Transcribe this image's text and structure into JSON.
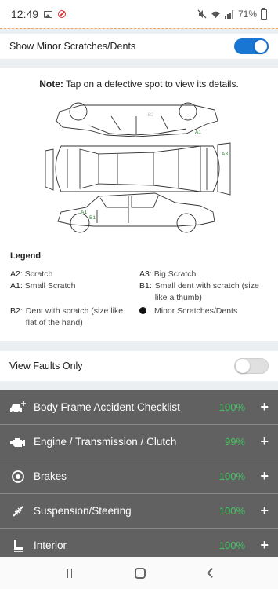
{
  "status_bar": {
    "time": "12:49",
    "battery": "71%"
  },
  "minor_toggle": {
    "label": "Show Minor Scratches/Dents",
    "on": true
  },
  "diagram": {
    "note_bold": "Note:",
    "note_text": " Tap on a defective spot to view its details.",
    "markers": [
      "A1",
      "A3",
      "A1",
      "B1"
    ]
  },
  "legend": {
    "title": "Legend",
    "items": [
      {
        "code": "A2:",
        "text": "Scratch"
      },
      {
        "code": "A3:",
        "text": "Big Scratch"
      },
      {
        "code": "A1:",
        "text": "Small Scratch"
      },
      {
        "code": "B1:",
        "text": "Small dent with scratch (size like a thumb)"
      },
      {
        "code": "B2:",
        "text": "Dent with scratch (size like flat of the hand)"
      },
      {
        "code": "",
        "text": "Minor Scratches/Dents"
      }
    ]
  },
  "faults_toggle": {
    "label": "View Faults Only",
    "on": false
  },
  "checklist": [
    {
      "label": "Body Frame Accident Checklist",
      "percent": "100%",
      "icon": "car-add-icon"
    },
    {
      "label": "Engine / Transmission / Clutch",
      "percent": "99%",
      "icon": "engine-icon"
    },
    {
      "label": "Brakes",
      "percent": "100%",
      "icon": "brake-icon"
    },
    {
      "label": "Suspension/Steering",
      "percent": "100%",
      "icon": "suspension-icon"
    },
    {
      "label": "Interior",
      "percent": "100%",
      "icon": "seat-icon"
    }
  ],
  "colors": {
    "toggle_on": "#1976d2",
    "checklist_bg": "#616161",
    "percent_green": "#43c463"
  }
}
